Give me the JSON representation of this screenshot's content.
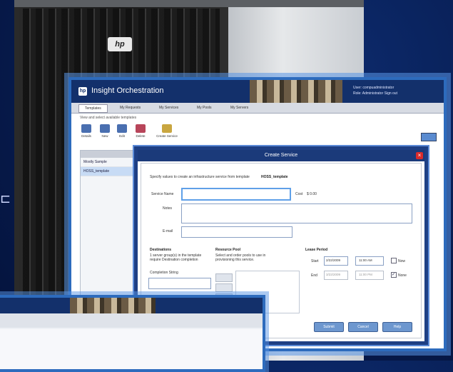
{
  "brand": {
    "hp_logo": "hp"
  },
  "main_window": {
    "title": "Insight Orchestration",
    "user_line1": "User: compuadministrator",
    "user_line2": "Role: Administrator   Sign out",
    "tabs": [
      "Templates",
      "My Requests",
      "My Services",
      "My Pools",
      "My Servers"
    ],
    "active_tab": 0,
    "subtitle": "View and select available templates",
    "toolbar": [
      "Details",
      "New",
      "Edit",
      "Delete",
      "Create Service"
    ],
    "list_items": [
      "Mostly Sample",
      "HOSS_template"
    ],
    "selected_list_index": 1
  },
  "dialog": {
    "title": "Create Service",
    "instruction": "Specify values to create an infrastructure service from template",
    "template_name": "HOSS_template",
    "service_name_label": "Service Name",
    "cost_label": "Cost",
    "cost_value": "$ 0.00",
    "notes_label": "Notes",
    "email_label": "E-mail",
    "destinations_heading": "Destinations",
    "destinations_text": "1 server group(s) in the template\nrequire Destination completion",
    "completion_string_label": "Completion String",
    "resource_pool_heading": "Resource Pool",
    "resource_pool_text": "Select and order pools to use in\nprovisioning this service.",
    "lease_period_heading": "Lease Period",
    "start_label": "Start",
    "start_date": "2/22/2009",
    "start_time": "11:00 AM",
    "now_label": "Now",
    "end_label": "End",
    "end_date": "3/22/2009",
    "end_time": "11:00 PM",
    "none_label": "None",
    "buttons": [
      "Submit",
      "Cancel",
      "Help"
    ]
  },
  "colors": {
    "background": "#071c4f",
    "header": "#13306b",
    "accent": "#2d6bbd",
    "close": "#d92b2b"
  }
}
